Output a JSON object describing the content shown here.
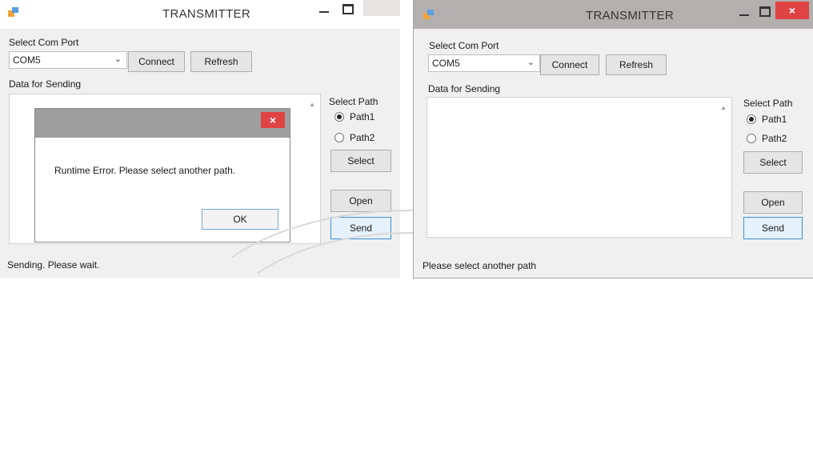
{
  "window_left": {
    "title": "TRANSMITTER",
    "com_port_label": "Select Com Port",
    "com_port_value": "COM5",
    "connect_label": "Connect",
    "refresh_label": "Refresh",
    "data_label": "Data for Sending",
    "select_path_label": "Select Path",
    "path1_label": "Path1",
    "path2_label": "Path2",
    "path_selected": "Path1",
    "select_button_label": "Select",
    "open_button_label": "Open",
    "send_button_label": "Send",
    "status_text": "Sending. Please wait.",
    "dialog": {
      "message": "Runtime Error. Please select another path.",
      "ok_label": "OK",
      "close_glyph": "×"
    }
  },
  "window_right": {
    "title": "TRANSMITTER",
    "com_port_label": "Select Com Port",
    "com_port_value": "COM5",
    "connect_label": "Connect",
    "refresh_label": "Refresh",
    "data_label": "Data for Sending",
    "select_path_label": "Select Path",
    "path1_label": "Path1",
    "path2_label": "Path2",
    "path_selected": "Path1",
    "select_button_label": "Select",
    "open_button_label": "Open",
    "send_button_label": "Send",
    "status_text": "Please select another path",
    "close_glyph": "×"
  },
  "icons": {
    "app": "app-icon",
    "minimize": "minimize-icon",
    "maximize": "maximize-icon",
    "close": "close-icon",
    "dropdown": "chevron-down-icon"
  },
  "colors": {
    "close_red": "#e04343",
    "window_bg": "#f0f0f0",
    "right_titlebar": "#b2afae",
    "dialog_titlebar": "#9e9e9e",
    "focus_blue": "#3c8fd6"
  }
}
